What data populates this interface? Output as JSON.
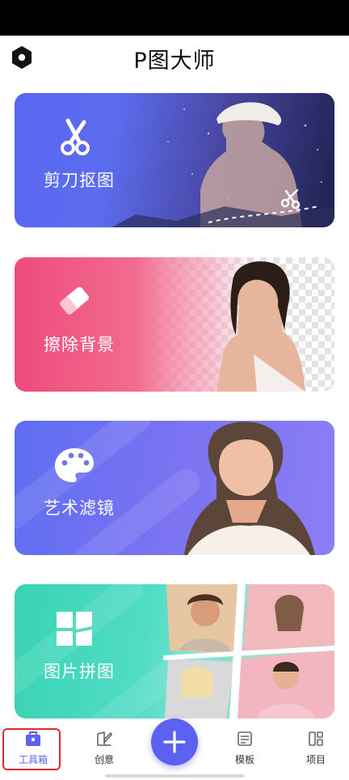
{
  "app": {
    "title": "P图大师"
  },
  "cards": [
    {
      "label": "剪刀抠图",
      "icon": "scissors-icon"
    },
    {
      "label": "擦除背景",
      "icon": "eraser-icon"
    },
    {
      "label": "艺术滤镜",
      "icon": "palette-icon"
    },
    {
      "label": "图片拼图",
      "icon": "collage-grid-icon"
    }
  ],
  "bottom_nav": {
    "items": [
      {
        "label": "工具箱",
        "icon": "toolbox-icon",
        "active": true
      },
      {
        "label": "创意",
        "icon": "creative-brush-icon",
        "active": false
      },
      {
        "label": "模板",
        "icon": "template-icon",
        "active": false
      },
      {
        "label": "项目",
        "icon": "project-icon",
        "active": false
      }
    ],
    "add_icon": "plus-icon"
  },
  "colors": {
    "accent": "#5b62f0",
    "selection_outline": "#e02a2a"
  }
}
